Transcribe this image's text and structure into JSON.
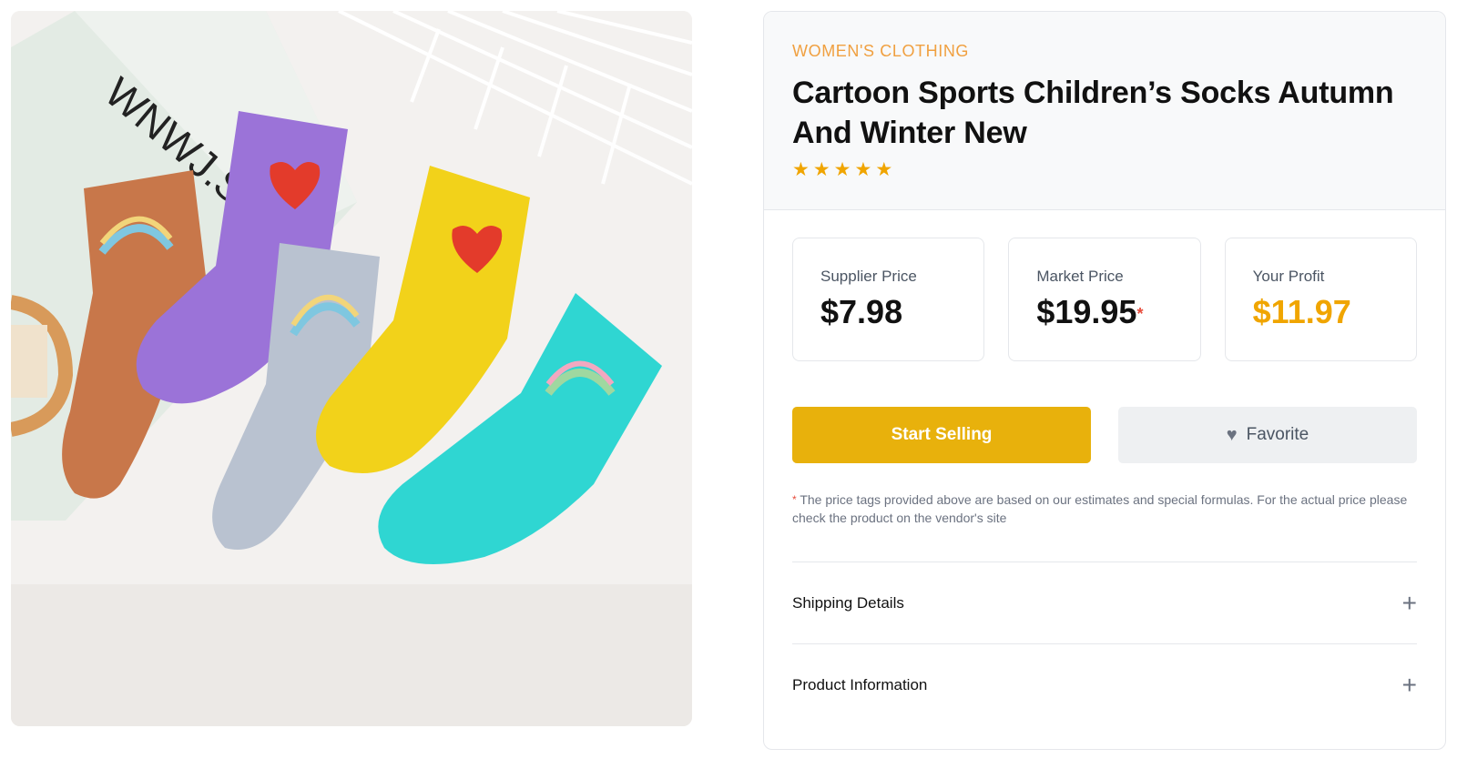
{
  "product": {
    "category": "WOMEN'S CLOTHING",
    "title": "Cartoon Sports Children’s Socks Autumn And Winter New",
    "rating": 5,
    "stars": [
      "★",
      "★",
      "★",
      "★",
      "★"
    ],
    "image_alt": "Five colorful children's socks"
  },
  "prices": {
    "supplier_label": "Supplier Price",
    "supplier_value": "$7.98",
    "market_label": "Market Price",
    "market_value": "$19.95",
    "market_asterisk": "*",
    "profit_label": "Your Profit",
    "profit_value": "$11.97"
  },
  "actions": {
    "start_selling": "Start Selling",
    "favorite": "Favorite"
  },
  "note": {
    "asterisk": "*",
    "text": "The price tags provided above are based on our estimates and special formulas. For the actual price please check the product on the vendor's site"
  },
  "accordion": {
    "items": [
      {
        "label": "Shipping Details",
        "icon": "+"
      },
      {
        "label": "Product Information",
        "icon": "+"
      }
    ]
  },
  "image_text": {
    "book_text": "WNWJ.S"
  },
  "colors": {
    "accent": "#e8b10c",
    "category": "#f0a040",
    "profit": "#f0a500",
    "star": "#f0a500"
  }
}
